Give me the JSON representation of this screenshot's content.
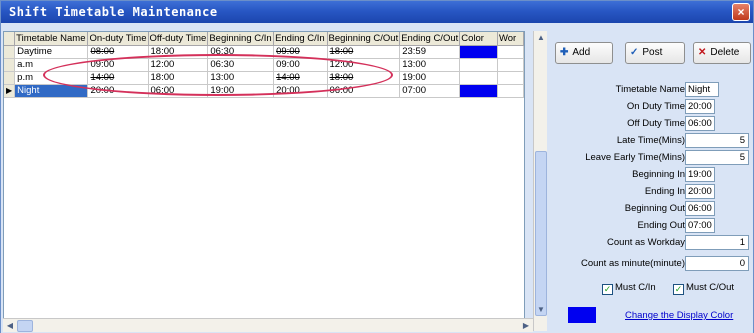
{
  "window": {
    "title": "Shift Timetable Maintenance",
    "close_glyph": "×"
  },
  "grid": {
    "columns": [
      "Timetable Name",
      "On-duty Time",
      "Off-duty Time",
      "Beginning C/In",
      "Ending C/In",
      "Beginning C/Out",
      "Ending C/Out",
      "Color",
      "Wor"
    ],
    "rows": [
      {
        "name": "Daytime",
        "on": "08:00",
        "off": "18:00",
        "bin": "06:30",
        "ein": "09:00",
        "bout": "18:00",
        "eout": "23:59",
        "color": "#0000f0"
      },
      {
        "name": "a.m",
        "on": "09:00",
        "off": "12:00",
        "bin": "06:30",
        "ein": "09:00",
        "bout": "12:00",
        "eout": "13:00",
        "color": ""
      },
      {
        "name": "p.m",
        "on": "14:00",
        "off": "18:00",
        "bin": "13:00",
        "ein": "14:00",
        "bout": "18:00",
        "eout": "19:00",
        "color": ""
      },
      {
        "name": "Night",
        "on": "20:00",
        "off": "06:00",
        "bin": "19:00",
        "ein": "20:00",
        "bout": "06:00",
        "eout": "07:00",
        "color": "#0000f0"
      }
    ],
    "selected_row": 3
  },
  "toolbar": {
    "add_label": "Add",
    "post_label": "Post",
    "delete_label": "Delete"
  },
  "form": {
    "timetable_name_label": "Timetable Name",
    "timetable_name": "Night",
    "on_duty_label": "On Duty Time",
    "on_duty": "20:00",
    "off_duty_label": "Off Duty Time",
    "off_duty": "06:00",
    "late_label": "Late Time(Mins)",
    "late": "5",
    "leave_early_label": "Leave Early Time(Mins)",
    "leave_early": "5",
    "beginning_in_label": "Beginning In",
    "beginning_in": "19:00",
    "ending_in_label": "Ending In",
    "ending_in": "20:00",
    "beginning_out_label": "Beginning Out",
    "beginning_out": "06:00",
    "ending_out_label": "Ending Out",
    "ending_out": "07:00",
    "count_workday_label": "Count as Workday",
    "count_workday": "1",
    "count_minute_label": "Count as minute(minute)",
    "count_minute": "0",
    "must_cin_label": "Must C/In",
    "must_cout_label": "Must C/Out",
    "display_color": "#0000f0",
    "change_color_label": "Change the Display Color"
  },
  "icons": {
    "add": "plus-icon",
    "post": "checkmark-icon",
    "delete": "x-icon"
  }
}
